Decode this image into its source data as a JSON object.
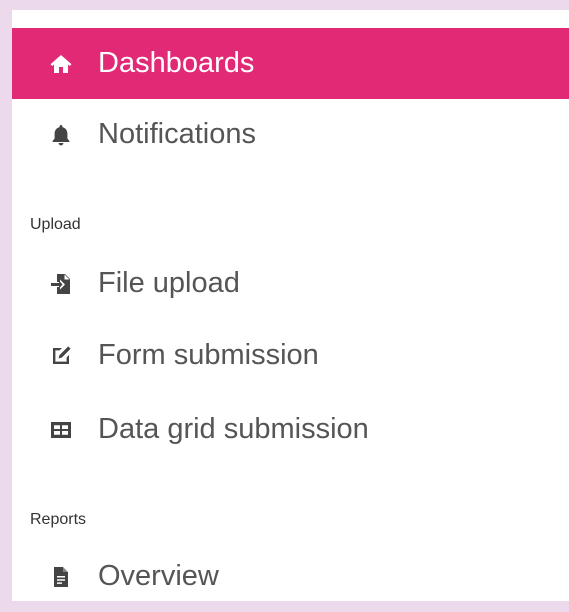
{
  "nav": {
    "dashboards": {
      "label": "Dashboards",
      "icon": "home-icon",
      "active": true
    },
    "notifications": {
      "label": "Notifications",
      "icon": "bell-icon"
    }
  },
  "upload": {
    "header": "Upload",
    "items": [
      {
        "label": "File upload",
        "icon": "file-import-icon"
      },
      {
        "label": "Form submission",
        "icon": "edit-icon"
      },
      {
        "label": "Data grid submission",
        "icon": "table-icon"
      }
    ]
  },
  "reports": {
    "header": "Reports",
    "items": [
      {
        "label": "Overview",
        "icon": "file-document-icon"
      }
    ]
  },
  "colors": {
    "active_background": "#e22976",
    "page_background": "#ecd9ec",
    "text": "#555555"
  }
}
